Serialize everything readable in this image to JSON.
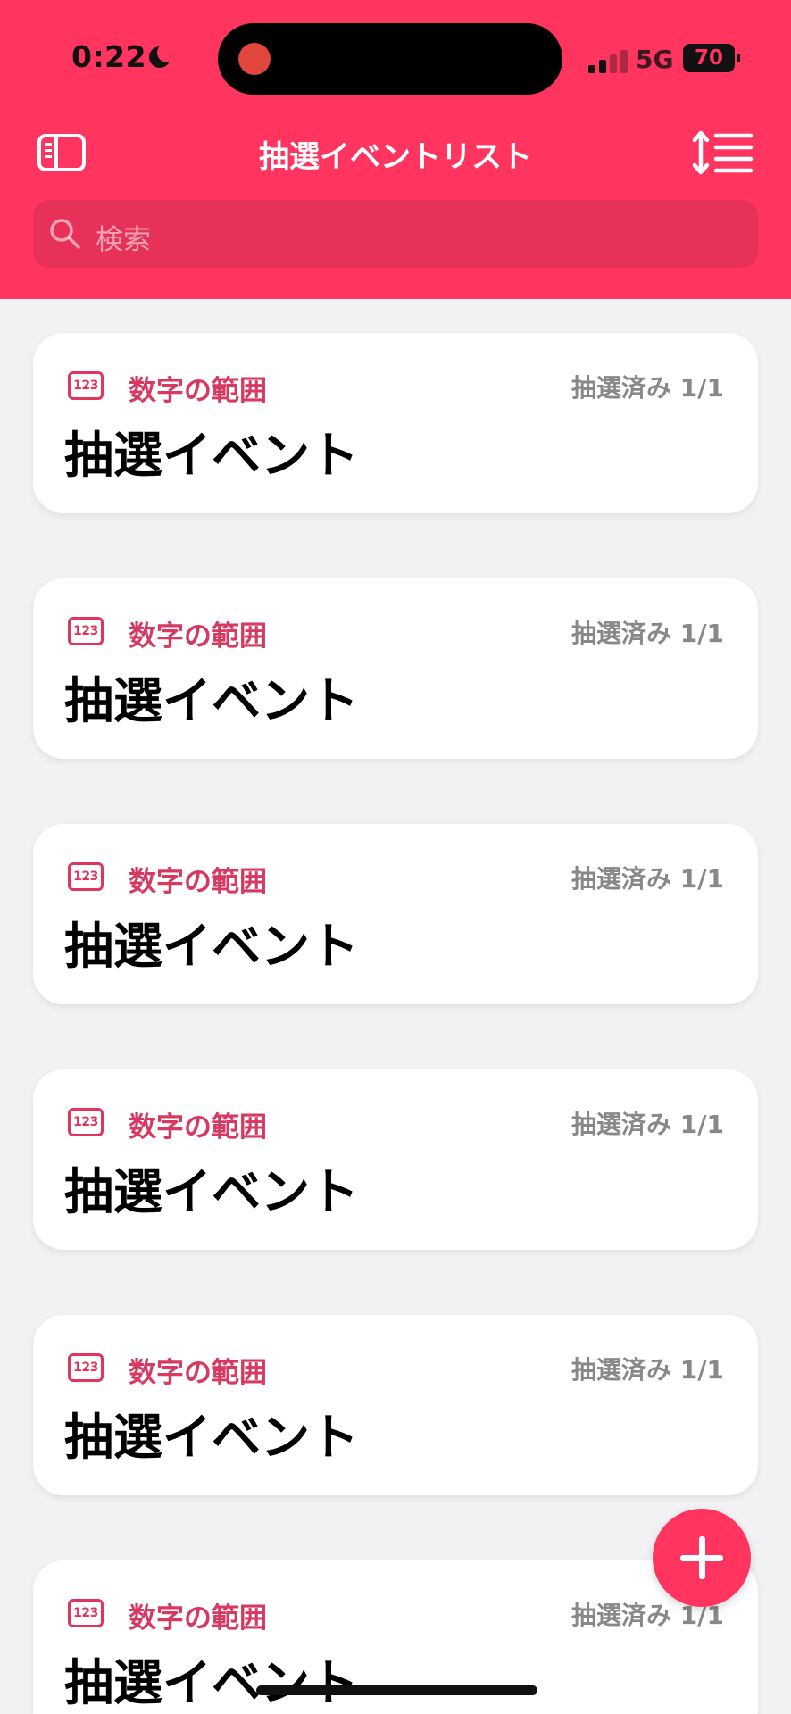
{
  "status_bar": {
    "time": "0:22",
    "network": "5G",
    "battery_percent": "70"
  },
  "nav": {
    "title": "抽選イベントリスト"
  },
  "search": {
    "placeholder": "検索"
  },
  "events": [
    {
      "type_icon_text": "123",
      "type_label": "数字の範囲",
      "status": "抽選済み 1/1",
      "name": "抽選イベント"
    },
    {
      "type_icon_text": "123",
      "type_label": "数字の範囲",
      "status": "抽選済み 1/1",
      "name": "抽選イベント"
    },
    {
      "type_icon_text": "123",
      "type_label": "数字の範囲",
      "status": "抽選済み 1/1",
      "name": "抽選イベント"
    },
    {
      "type_icon_text": "123",
      "type_label": "数字の範囲",
      "status": "抽選済み 1/1",
      "name": "抽選イベント"
    },
    {
      "type_icon_text": "123",
      "type_label": "数字の範囲",
      "status": "抽選済み 1/1",
      "name": "抽選イベント"
    },
    {
      "type_icon_text": "123",
      "type_label": "数字の範囲",
      "status": "抽選済み 1/1",
      "name": "抽選イベント"
    }
  ],
  "icons": {
    "sidebar": "sidebar-icon",
    "sort": "sort-icon",
    "search": "search-icon",
    "add": "plus-icon",
    "type": "number-range-icon"
  },
  "colors": {
    "accent": "#FF3560",
    "type_label": "#D63A62",
    "status_text": "#888888",
    "background": "#F2F2F4"
  }
}
